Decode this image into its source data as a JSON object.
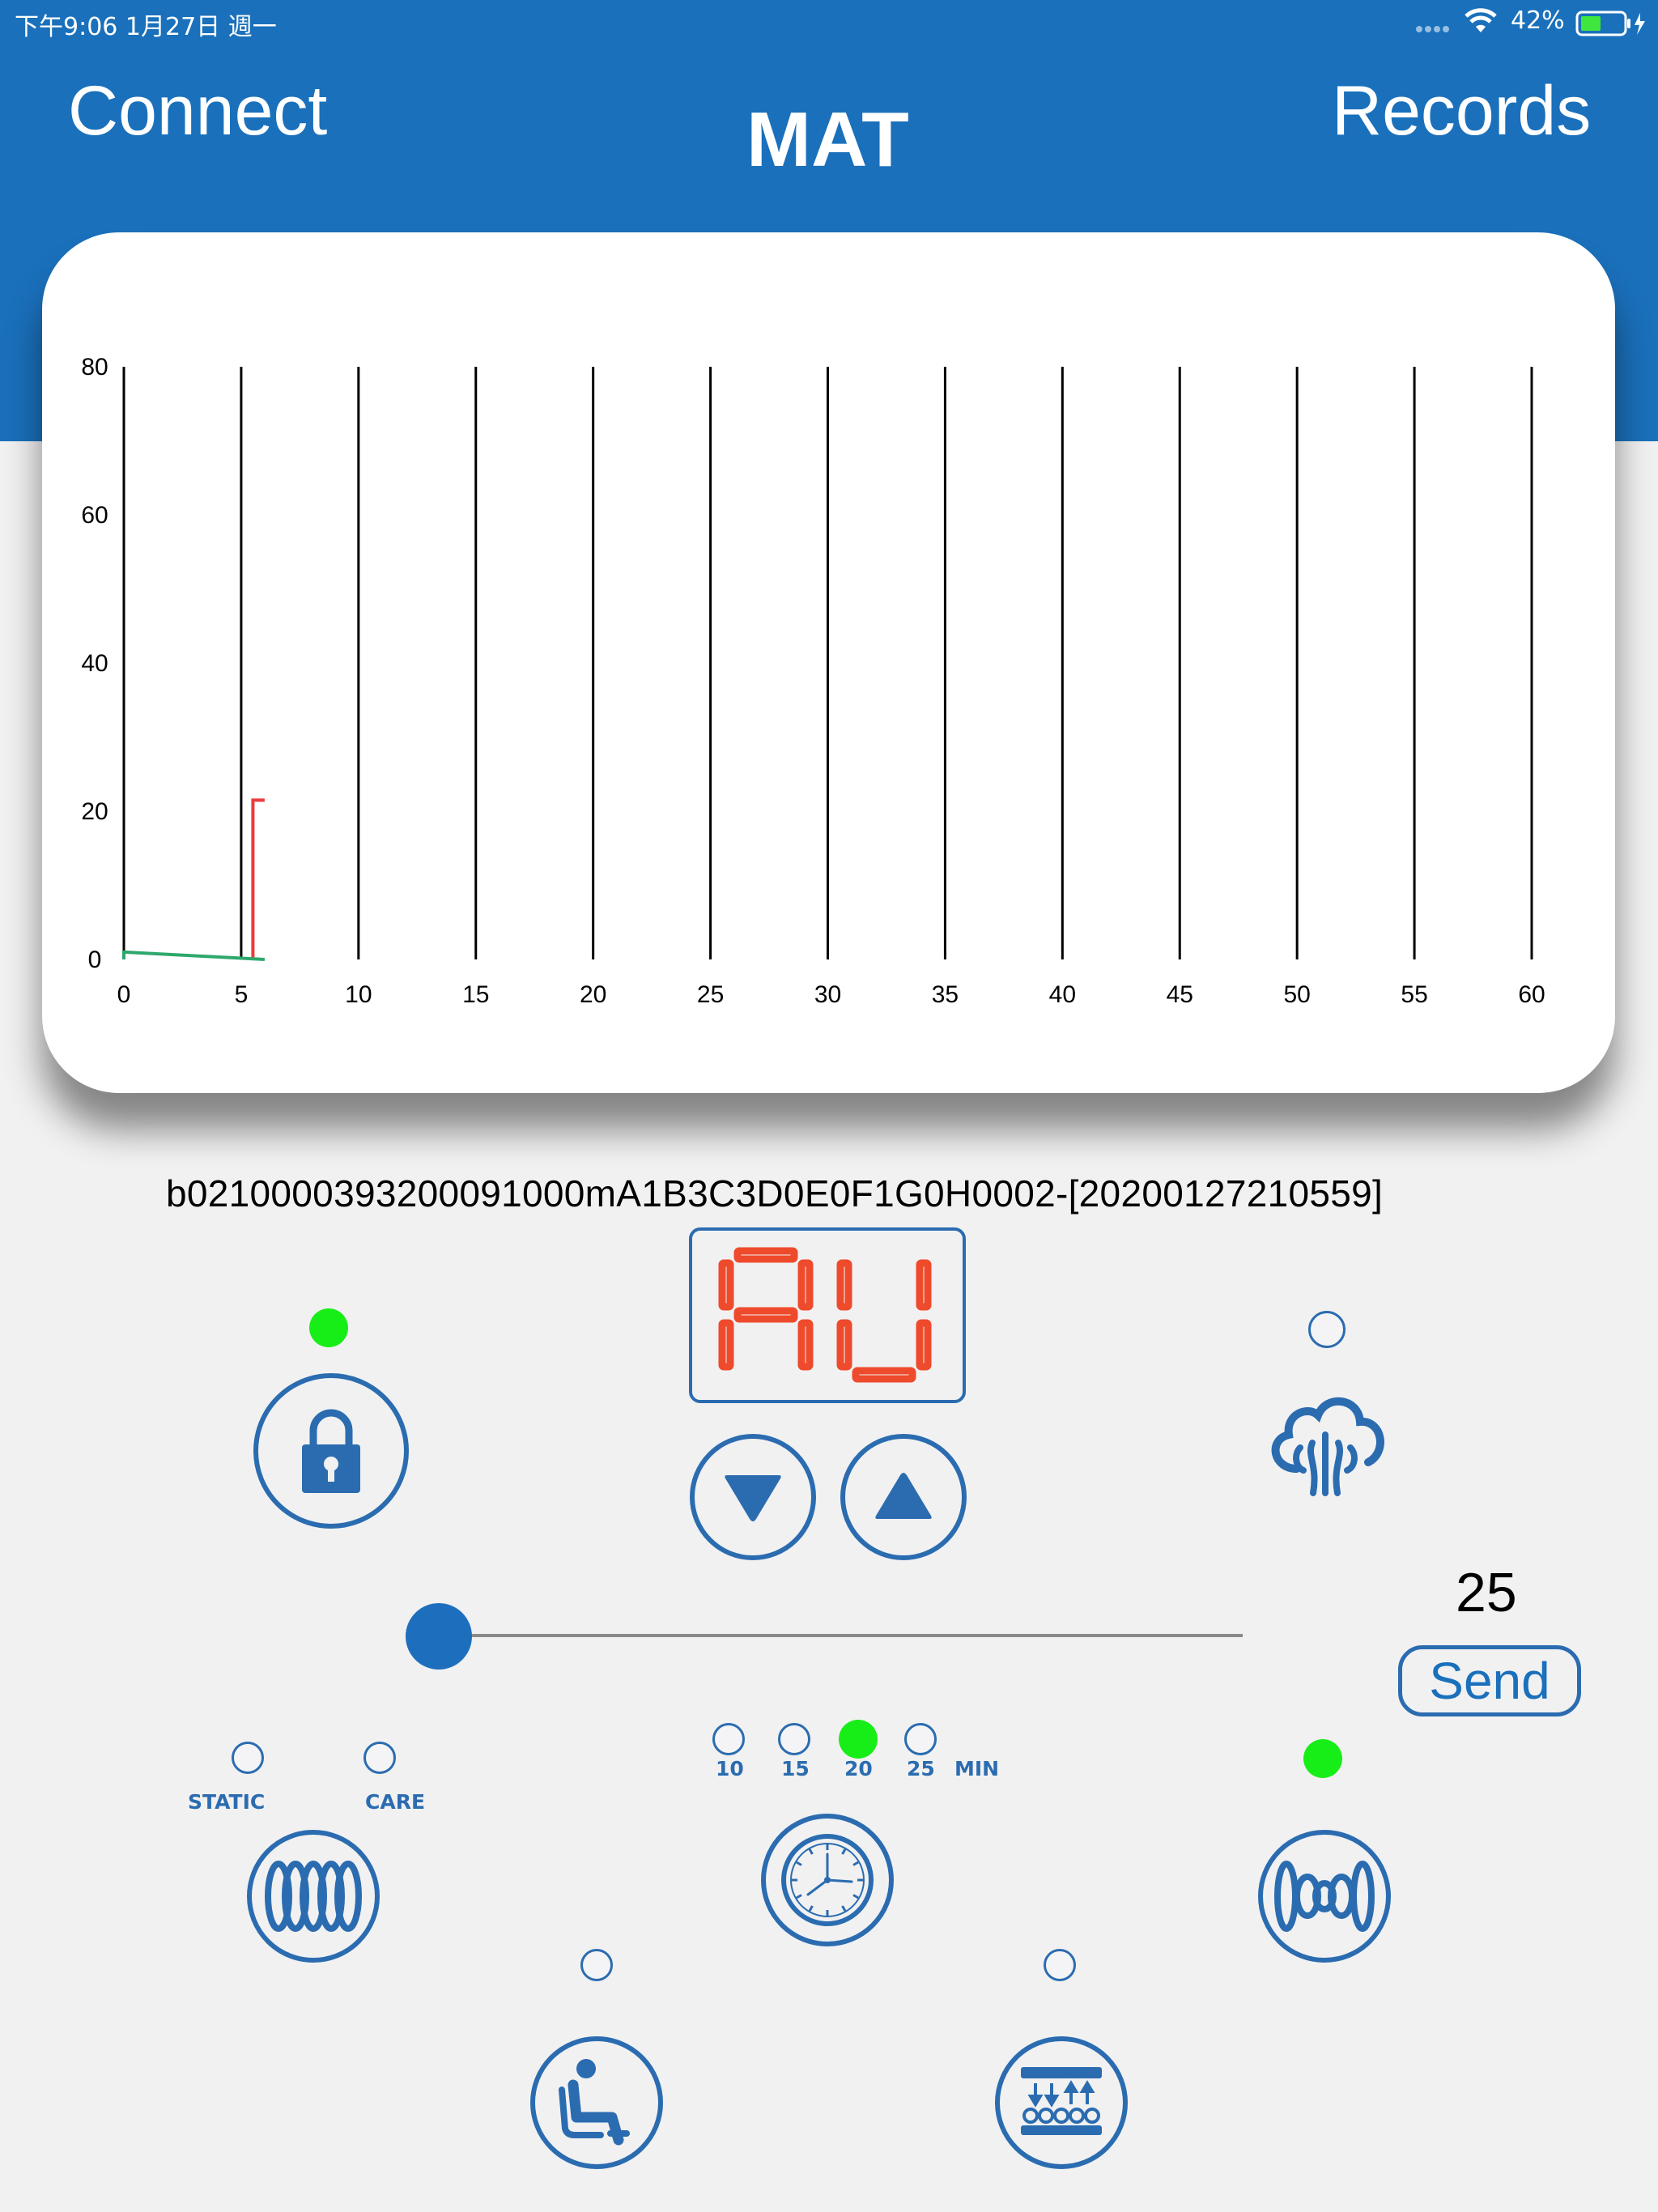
{
  "status_bar": {
    "time_date": "下午9:06   1月27日 週一",
    "battery": "42%"
  },
  "nav": {
    "left_button": "Connect",
    "title": "MAT",
    "right_button": "Records"
  },
  "chart_data": {
    "type": "line",
    "x_ticks": [
      "0",
      "5",
      "10",
      "15",
      "20",
      "25",
      "30",
      "35",
      "40",
      "45",
      "50",
      "55",
      "60"
    ],
    "y_ticks": [
      "0",
      "20",
      "40",
      "60",
      "80"
    ],
    "xlim": [
      0,
      60
    ],
    "ylim": [
      0,
      80
    ],
    "grid": "vertical lines",
    "series": [
      {
        "color": "#ec3a3a",
        "points": [
          [
            5.5,
            0
          ],
          [
            5.5,
            21.5
          ],
          [
            6.0,
            21.5
          ]
        ]
      },
      {
        "color": "#2ea86c",
        "points": [
          [
            0,
            0
          ],
          [
            0,
            1
          ],
          [
            6.0,
            0
          ]
        ]
      }
    ]
  },
  "data_string": "b021000039320009100​0mA1B3C3D0E0F1G0H0002-[20200127210559]",
  "display": {
    "value": "AU",
    "color": "#ee4a2c"
  },
  "controls": {
    "lock_icon": "lock-icon",
    "steam_icon": "steam-icon",
    "down_icon": "triangle-down-icon",
    "up_icon": "triangle-up-icon",
    "slider_value_label": "25",
    "slider_value": 0,
    "send_label": "Send",
    "mode_static": "STATIC",
    "mode_care": "CARE",
    "timer_options": [
      "10",
      "15",
      "20",
      "25"
    ],
    "timer_unit": "MIN",
    "timer_selected": "20"
  },
  "colors": {
    "header_blue": "#1a70bb",
    "icon_blue": "#2b6cb0",
    "indicator_on": "#17ee17"
  }
}
